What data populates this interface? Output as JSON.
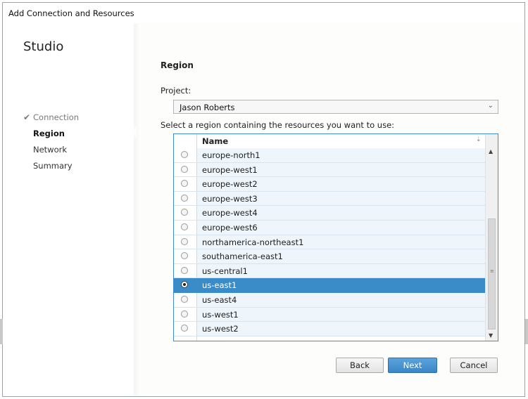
{
  "window": {
    "title": "Add Connection and Resources"
  },
  "nav": {
    "heading": "Studio",
    "items": [
      {
        "label": "Connection",
        "state": "done"
      },
      {
        "label": "Region",
        "state": "active"
      },
      {
        "label": "Network",
        "state": "pending"
      },
      {
        "label": "Summary",
        "state": "pending"
      }
    ]
  },
  "main": {
    "heading": "Region",
    "project_label": "Project:",
    "project_value": "Jason Roberts",
    "select_label": "Select a region containing the resources you want to use:",
    "column_name": "Name",
    "regions": [
      "europe-north1",
      "europe-west1",
      "europe-west2",
      "europe-west3",
      "europe-west4",
      "europe-west6",
      "northamerica-northeast1",
      "southamerica-east1",
      "us-central1",
      "us-east1",
      "us-east4",
      "us-west1",
      "us-west2"
    ],
    "selected_region": "us-east1"
  },
  "buttons": {
    "back": "Back",
    "next": "Next",
    "cancel": "Cancel"
  },
  "colors": {
    "accent": "#3a8cc9",
    "row_alt": "#eef5fb"
  },
  "icons": {
    "check": "checkmark-icon",
    "dropdown": "chevron-down-icon",
    "sort": "sort-arrow-icon"
  }
}
